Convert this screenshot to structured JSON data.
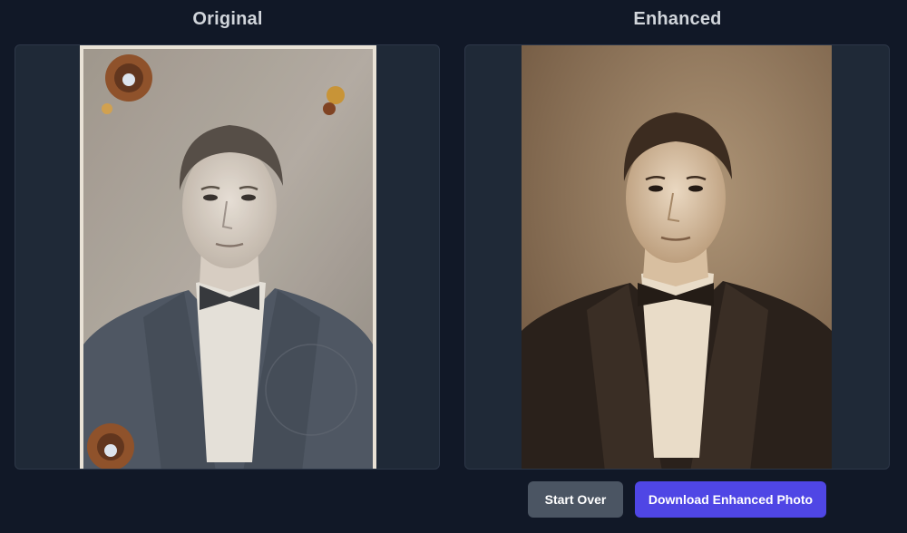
{
  "columns": {
    "original_title": "Original",
    "enhanced_title": "Enhanced"
  },
  "photos": {
    "original": {
      "subject": "sepia vintage portrait, damaged",
      "paper": "#a59e95"
    },
    "enhanced": {
      "subject": "sepia vintage portrait, restored",
      "paper": "#8c7056"
    }
  },
  "actions": {
    "start_over_label": "Start Over",
    "download_label": "Download Enhanced Photo"
  },
  "colors": {
    "background": "#111827",
    "panel": "#1f2937",
    "primary_button": "#4f46e5",
    "secondary_button": "#4b5563"
  }
}
